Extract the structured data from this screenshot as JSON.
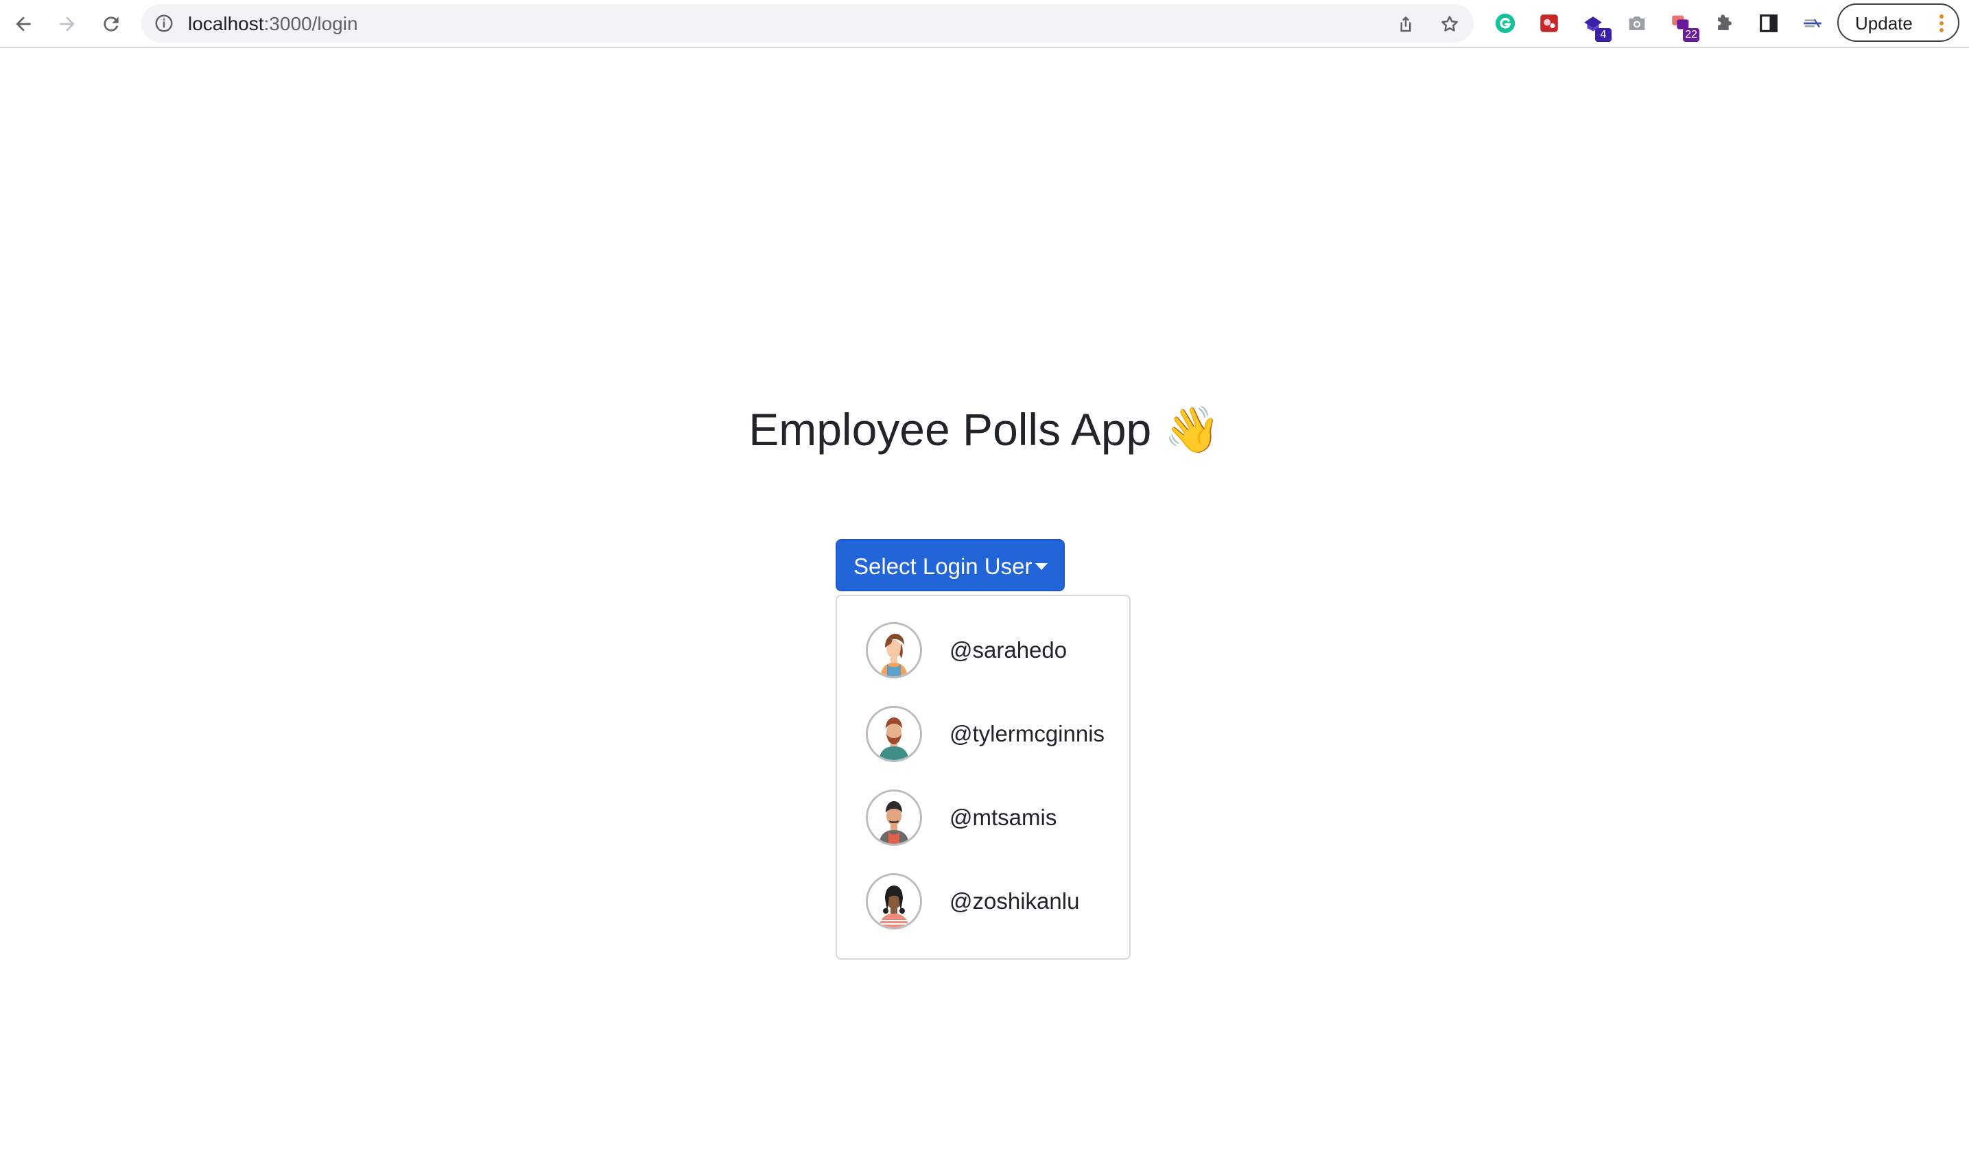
{
  "browser": {
    "url_host": "localhost",
    "url_path": ":3000/login",
    "update_label": "Update",
    "extensions": [
      {
        "icon": "grammarly-icon",
        "color": "#15c39a"
      },
      {
        "icon": "red-extension-icon",
        "color": "#c62828"
      },
      {
        "icon": "purple-extension-icon",
        "color": "#3c1fa8",
        "badge": "4"
      },
      {
        "icon": "camera-icon",
        "color": "#9aa0a6"
      },
      {
        "icon": "tabs-extension-icon",
        "color": "#6a1b9a",
        "badge": "22"
      },
      {
        "icon": "puzzle-icon",
        "color": "#5f6368"
      },
      {
        "icon": "side-panel-icon",
        "color": "#202124"
      },
      {
        "icon": "strikethrough-extension-icon",
        "color": "#3c4fb0"
      }
    ]
  },
  "page": {
    "title": "Employee Polls App",
    "title_emoji": "👋"
  },
  "login": {
    "button_label": "Select Login User",
    "accent_color": "#2165d8",
    "users": [
      {
        "handle": "@sarahedo",
        "avatar": "avatar-sarahedo"
      },
      {
        "handle": "@tylermcginnis",
        "avatar": "avatar-tylermcginnis"
      },
      {
        "handle": "@mtsamis",
        "avatar": "avatar-mtsamis"
      },
      {
        "handle": "@zoshikanlu",
        "avatar": "avatar-zoshikanlu"
      }
    ]
  }
}
